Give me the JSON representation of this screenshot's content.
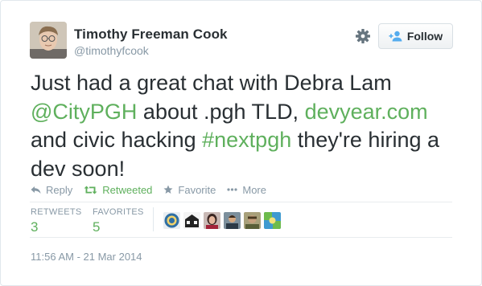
{
  "user": {
    "name": "Timothy Freeman Cook",
    "handle": "@timothyfcook"
  },
  "follow_button": {
    "label": "Follow"
  },
  "tweet": {
    "parts": [
      {
        "text": "Just had a great chat with Debra Lam ",
        "link": false
      },
      {
        "text": "@CityPGH",
        "link": true
      },
      {
        "text": " about .pgh TLD, ",
        "link": false
      },
      {
        "text": "devyear.com",
        "link": true
      },
      {
        "text": " and civic hacking ",
        "link": false
      },
      {
        "text": "#nextpgh",
        "link": true
      },
      {
        "text": " they're hiring a dev soon!",
        "link": false
      }
    ]
  },
  "actions": {
    "reply": "Reply",
    "retweet": "Retweeted",
    "favorite": "Favorite",
    "more": "More"
  },
  "stats": {
    "retweets_label": "RETWEETS",
    "retweets_count": "3",
    "favorites_label": "FAVORITES",
    "favorites_count": "5"
  },
  "timestamp": "11:56 AM - 21 Mar 2014",
  "colors": {
    "link": "#5fb05d",
    "muted": "#8899a6",
    "text": "#292f33",
    "follow_icon": "#55acee"
  },
  "icons": {
    "settings": "gear-icon",
    "follow": "add-user-icon",
    "reply": "reply-icon",
    "retweet": "retweet-icon",
    "favorite": "star-icon",
    "more": "ellipsis-icon"
  }
}
